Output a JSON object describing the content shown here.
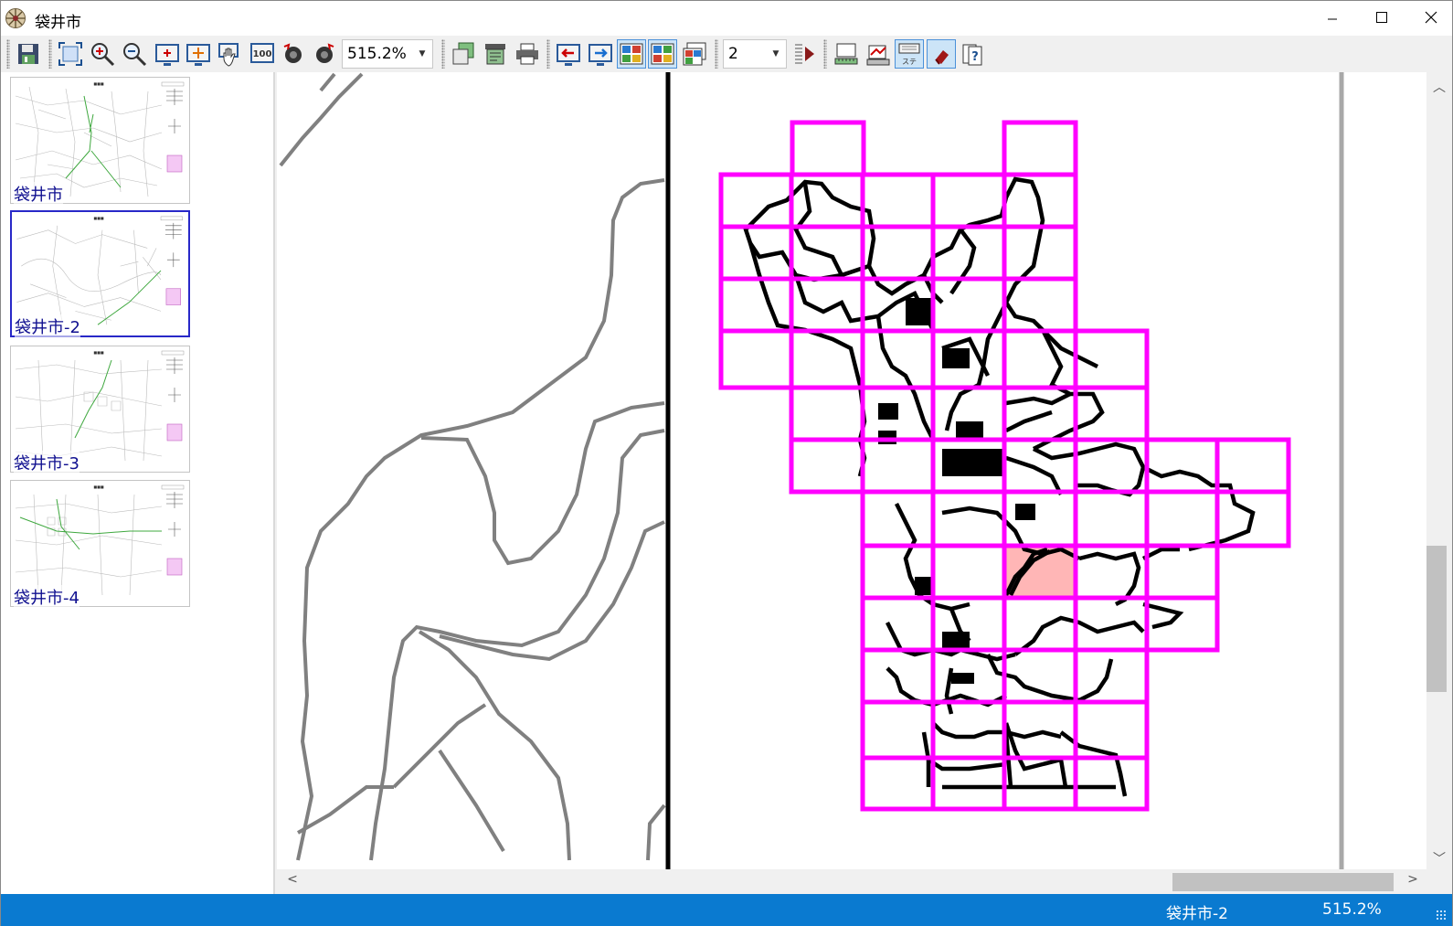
{
  "window": {
    "title": "袋井市",
    "controls": {
      "minimize": "minimize",
      "maximize": "maximize",
      "close": "close"
    }
  },
  "toolbar": {
    "zoom_value": "515.2%",
    "page_value": "2",
    "buttons": [
      "save-icon",
      "fit-page-icon",
      "zoom-in-icon",
      "zoom-out-icon",
      "zoom-area-icon",
      "pan-center-icon",
      "hand-tool-icon",
      "zoom-100-icon",
      "rotate-left-icon",
      "rotate-right-icon",
      "copy-icon",
      "print-preview-icon",
      "printer-icon",
      "previous-page-icon",
      "next-page-icon",
      "layout-single-icon",
      "layout-grid-icon",
      "layout-multi-icon",
      "go-to-page-icon",
      "ruler-icon",
      "measure-icon",
      "stamp-icon",
      "eraser-icon",
      "help-icon"
    ]
  },
  "thumbnails": [
    {
      "label": "袋井市",
      "selected": false
    },
    {
      "label": "袋井市-2",
      "selected": true
    },
    {
      "label": "袋井市-3",
      "selected": false
    },
    {
      "label": "袋井市-4",
      "selected": false
    }
  ],
  "map": {
    "index_grid_color": "#ff00ff",
    "highlight_cell_color": "#ffb6b6",
    "contour_color": "#808080",
    "boundary_color": "#000000"
  },
  "statusbar": {
    "document": "袋井市-2",
    "zoom": "515.2%"
  },
  "colors": {
    "accent": "#0a7ad0",
    "selected_thumb_border": "#2828c8"
  }
}
